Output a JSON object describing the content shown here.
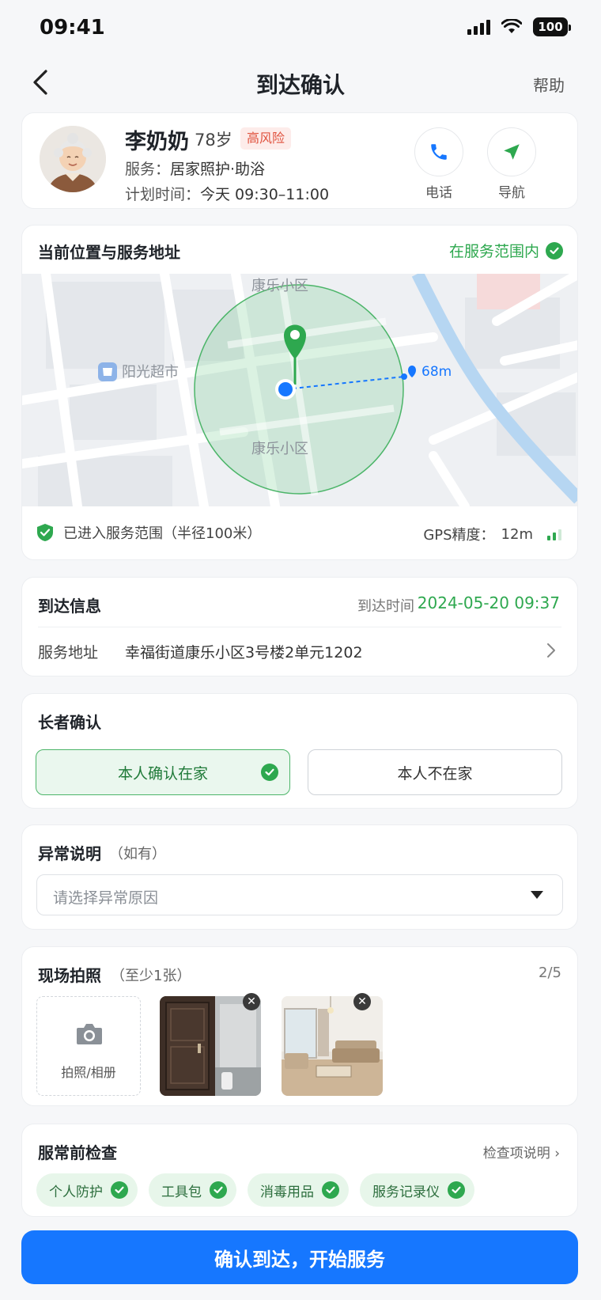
{
  "status_bar": {
    "time": "09:41",
    "battery": "100"
  },
  "nav": {
    "title": "到达确认",
    "help": "帮助"
  },
  "patient": {
    "name": "李奶奶",
    "age": "78岁",
    "risk": "高风险",
    "service_label": "服务：",
    "service_value": "居家照护·助浴",
    "plan_label": "计划时间：",
    "plan_value": "今天 09:30–11:00",
    "call_label": "电话",
    "navigate_label": "导航"
  },
  "location": {
    "title": "当前位置与服务地址",
    "status": "在服务范围内",
    "map_labels": {
      "community_top": "康乐小区",
      "community_bottom": "康乐小区",
      "poi": "阳光超市",
      "distance": "68m"
    },
    "range_text": "已进入服务范围（半径100米）",
    "gps_label": "GPS精度：",
    "gps_value": "12m"
  },
  "arrival": {
    "title": "到达信息",
    "time_label": "到达时间",
    "time_value": "2024-05-20 09:37",
    "address_label": "服务地址",
    "address_value": "幸福街道康乐小区3号楼2单元1202"
  },
  "elder": {
    "title": "长者确认",
    "option_home": "本人确认在家",
    "option_away": "本人不在家",
    "selected": "home"
  },
  "abnormal": {
    "title": "异常说明",
    "subtitle": "（如有）",
    "placeholder": "请选择异常原因"
  },
  "photos": {
    "title": "现场拍照",
    "subtitle": "（至少1张）",
    "count": "2/5",
    "add_label": "拍照/相册"
  },
  "checks": {
    "title": "服常前检查",
    "link": "检查项说明",
    "items": [
      "个人防护",
      "工具包",
      "消毒用品",
      "服务记录仪"
    ]
  },
  "footer": {
    "confirm_label": "确认到达，开始服务"
  },
  "colors": {
    "primary": "#1677ff",
    "success": "#2ea84f",
    "risk": "#e0523e"
  }
}
